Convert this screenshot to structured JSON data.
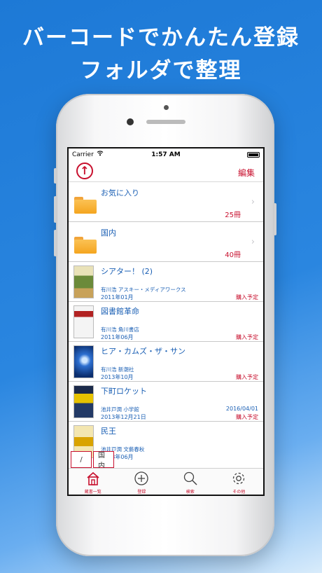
{
  "promo": {
    "line1": "バーコードでかんたん登録",
    "line2": "フォルダで整理"
  },
  "status_bar": {
    "carrier": "Carrier",
    "time": "1:57 AM"
  },
  "nav": {
    "edit_label": "編集",
    "up_icon": "arrow-up-circle-icon",
    "up_label": "↑"
  },
  "folders": [
    {
      "name": "お気に入り",
      "count": "25冊"
    },
    {
      "name": "国内",
      "count": "40冊"
    }
  ],
  "books": [
    {
      "title": "シアター！ (2)",
      "meta": "有川浩 アスキー・メディアワークス",
      "date": "2011年01月",
      "status": "購入予定",
      "extra": ""
    },
    {
      "title": "図書館革命",
      "meta": "有川浩 角川書店",
      "date": "2011年06月",
      "status": "購入予定",
      "extra": ""
    },
    {
      "title": "ヒア・カムズ・ザ・サン",
      "meta": "有川浩 新潮社",
      "date": "2013年10月",
      "status": "購入予定",
      "extra": ""
    },
    {
      "title": "下町ロケット",
      "meta": "池井戸潤 小学館",
      "date": "2013年12月21日",
      "status": "購入予定",
      "extra": "2016/04/01"
    },
    {
      "title": "民王",
      "meta": "池井戸潤 文藝春秋",
      "date": "2013年06月",
      "status": "",
      "extra": ""
    }
  ],
  "breadcrumb": {
    "root": "/",
    "current": "国内"
  },
  "tabs": [
    {
      "label": "蔵書一覧",
      "icon": "home-icon"
    },
    {
      "label": "登録",
      "icon": "add-circle-icon"
    },
    {
      "label": "検索",
      "icon": "search-icon"
    },
    {
      "label": "その他",
      "icon": "gear-icon"
    }
  ],
  "colors": {
    "accent": "#c8102e",
    "text_blue": "#1a5fb4",
    "background": "#1d79d6"
  }
}
